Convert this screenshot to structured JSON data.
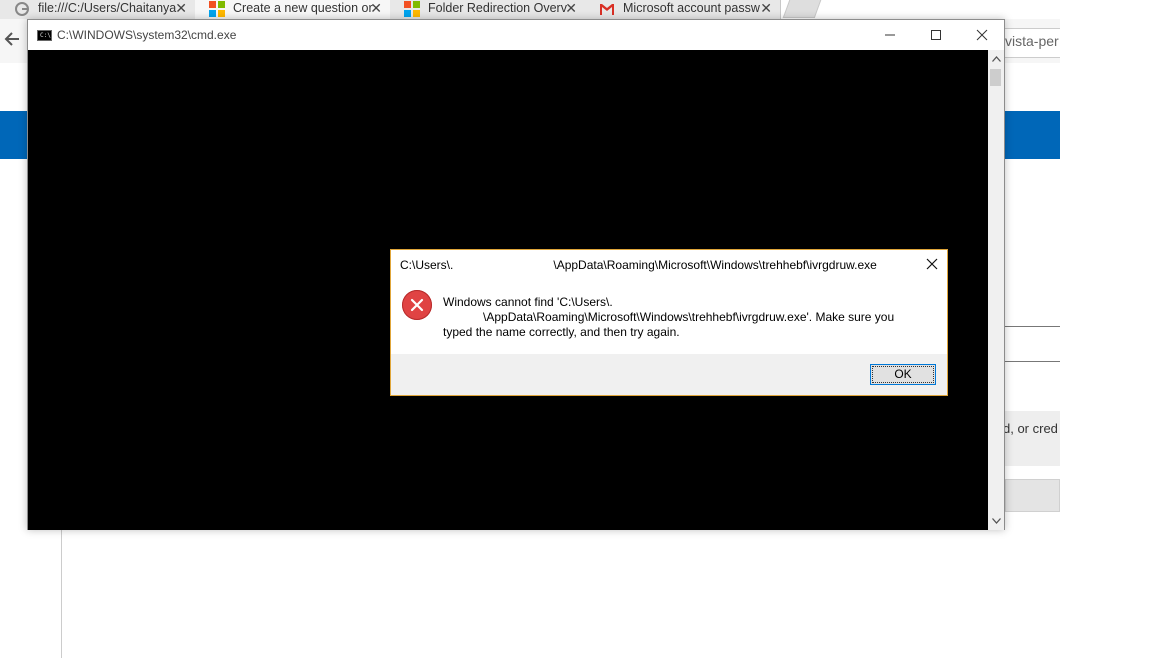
{
  "browser": {
    "tabs": [
      {
        "title": "file:///C:/Users/Chaitanya",
        "icon": "google-icon"
      },
      {
        "title": "Create a new question or",
        "icon": "microsoft-icon",
        "active": true
      },
      {
        "title": "Folder Redirection Overv",
        "icon": "microsoft-icon"
      },
      {
        "title": "Microsoft account passw",
        "icon": "gmail-icon"
      }
    ],
    "tab_close_glyph": "✕",
    "url_fragment": "vista-per",
    "page_fragment_text": "d, or cred"
  },
  "cmd": {
    "title": "C:\\WINDOWS\\system32\\cmd.exe",
    "minimize_glyph": "—",
    "maximize_glyph": "☐",
    "close_glyph": "✕"
  },
  "dialog": {
    "title": "C:\\Users\\.                              \\AppData\\Roaming\\Microsoft\\Windows\\trehhebf\\ivrgdruw.exe",
    "close_glyph": "✕",
    "message_line1": "Windows cannot find 'C:\\Users\\.",
    "message_line2": "            \\AppData\\Roaming\\Microsoft\\Windows\\trehhebf\\ivrgdruw.exe'. Make sure you",
    "message_line3": "typed the name correctly, and then try again.",
    "ok_label": "OK",
    "accent_border": "#e0a63a",
    "error_color": "#e04343"
  }
}
